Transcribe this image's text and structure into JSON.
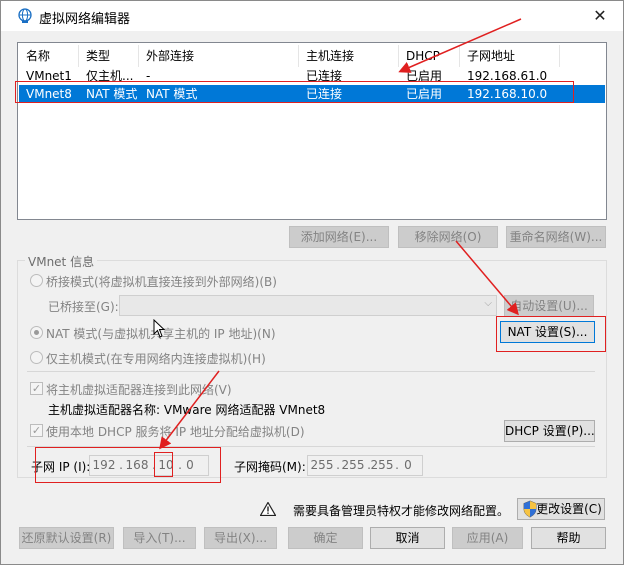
{
  "window": {
    "title": "虚拟网络编辑器",
    "close_glyph": "✕"
  },
  "network_table": {
    "columns": [
      "名称",
      "类型",
      "外部连接",
      "主机连接",
      "DHCP",
      "子网地址"
    ],
    "rows": [
      {
        "name": "VMnet1",
        "type": "仅主机...",
        "external": "-",
        "host": "已连接",
        "dhcp": "已启用",
        "subnet": "192.168.61.0"
      },
      {
        "name": "VMnet8",
        "type": "NAT 模式",
        "external": "NAT 模式",
        "host": "已连接",
        "dhcp": "已启用",
        "subnet": "192.168.10.0"
      }
    ],
    "selected_index": 1
  },
  "table_buttons": {
    "add": "添加网络(E)...",
    "remove": "移除网络(O)",
    "rename": "重命名网络(W)..."
  },
  "vmnet_info": {
    "group_label": "VMnet 信息",
    "bridged_label": "桥接模式(将虚拟机直接连接到外部网络)(B)",
    "bridged_to_label": "已桥接至(G):",
    "bridged_to_value": "",
    "auto_settings": "自动设置(U)...",
    "nat_label": "NAT 模式(与虚拟机共享主机的 IP 地址)(N)",
    "nat_settings": "NAT 设置(S)...",
    "hostonly_label": "仅主机模式(在专用网络内连接虚拟机)(H)",
    "connect_adapter_label": "将主机虚拟适配器连接到此网络(V)",
    "adapter_name_label": "主机虚拟适配器名称: VMware 网络适配器 VMnet8",
    "use_dhcp_label": "使用本地 DHCP 服务将 IP 地址分配给虚拟机(D)",
    "dhcp_settings": "DHCP 设置(P)...",
    "subnet_ip_label": "子网 IP (I):",
    "subnet_ip": [
      "192",
      "168",
      "10",
      "0"
    ],
    "subnet_mask_label": "子网掩码(M):",
    "subnet_mask": [
      "255",
      "255",
      "255",
      "0"
    ],
    "selected_mode": "nat"
  },
  "admin_notice": {
    "text": "需要具备管理员特权才能修改网络配置。",
    "change_settings": "更改设置(C)"
  },
  "footer_buttons": {
    "restore_defaults": "还原默认设置(R)",
    "import": "导入(T)...",
    "export": "导出(X)...",
    "ok": "确定",
    "cancel": "取消",
    "apply": "应用(A)",
    "help": "帮助"
  },
  "colors": {
    "selection": "#0078d7",
    "annotation_red": "#e02020"
  }
}
